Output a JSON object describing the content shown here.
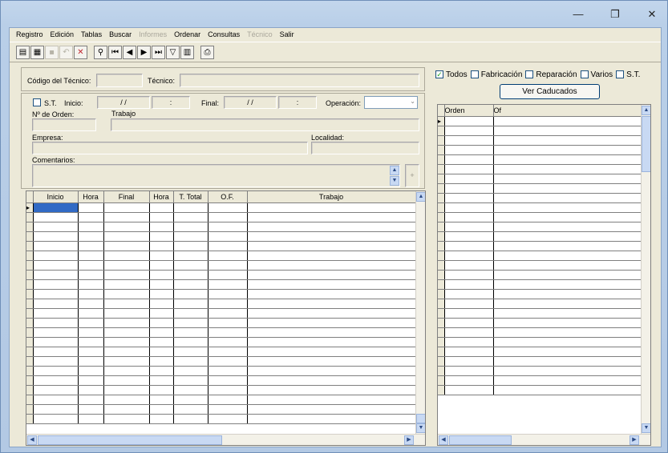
{
  "window": {
    "minimize": "—",
    "maximize": "❐",
    "close": "✕"
  },
  "menu": [
    {
      "label": "Registro",
      "enabled": true
    },
    {
      "label": "Edición",
      "enabled": true
    },
    {
      "label": "Tablas",
      "enabled": true
    },
    {
      "label": "Buscar",
      "enabled": true
    },
    {
      "label": "Informes",
      "enabled": false
    },
    {
      "label": "Ordenar",
      "enabled": true
    },
    {
      "label": "Consultas",
      "enabled": true
    },
    {
      "label": "Técnico",
      "enabled": false
    },
    {
      "label": "Salir",
      "enabled": true
    }
  ],
  "toolbar": {
    "icons": [
      {
        "name": "new-record-icon",
        "glyph": "▤",
        "enabled": true
      },
      {
        "name": "edit-record-icon",
        "glyph": "▦",
        "enabled": true
      },
      {
        "name": "save-icon",
        "glyph": "▪",
        "enabled": false
      },
      {
        "name": "undo-icon",
        "glyph": "↶",
        "enabled": false
      },
      {
        "name": "delete-icon",
        "glyph": "✕",
        "enabled": true
      },
      {
        "name": "find-icon",
        "glyph": "⚲",
        "enabled": true
      },
      {
        "name": "first-record-icon",
        "glyph": "⏮",
        "enabled": true
      },
      {
        "name": "previous-record-icon",
        "glyph": "◀",
        "enabled": true
      },
      {
        "name": "next-record-icon",
        "glyph": "▶",
        "enabled": true
      },
      {
        "name": "last-record-icon",
        "glyph": "⏭",
        "enabled": true
      },
      {
        "name": "filter-icon",
        "glyph": "▽",
        "enabled": true
      },
      {
        "name": "report-icon",
        "glyph": "▥",
        "enabled": true
      },
      {
        "name": "print-icon",
        "glyph": "⎙",
        "enabled": true
      }
    ]
  },
  "form": {
    "codigo_tecnico_label": "Código del Técnico:",
    "codigo_tecnico_value": "",
    "tecnico_label": "Técnico:",
    "tecnico_value": "",
    "st_label": "S.T.",
    "inicio_label": "Inicio:",
    "inicio_date": "/ /",
    "inicio_time": ":",
    "final_label": "Final:",
    "final_date": "/ /",
    "final_time": ":",
    "operacion_label": "Operación:",
    "operacion_value": "",
    "num_orden_label": "Nº de Orden:",
    "num_orden_value": "",
    "trabajo_label": "Trabajo",
    "trabajo_value": "",
    "empresa_label": "Empresa:",
    "empresa_value": "",
    "localidad_label": "Localidad:",
    "localidad_value": "",
    "comentarios_label": "Comentarios:",
    "comentarios_value": "",
    "plus_label": "+"
  },
  "left_grid": {
    "columns": [
      "Inicio",
      "Hora",
      "Final",
      "Hora",
      "T. Total",
      "O.F.",
      "Trabajo"
    ]
  },
  "filters": [
    {
      "label": "Todos",
      "checked": true
    },
    {
      "label": "Fabricación",
      "checked": false
    },
    {
      "label": "Reparación",
      "checked": false
    },
    {
      "label": "Varios",
      "checked": false
    },
    {
      "label": "S.T.",
      "checked": false
    }
  ],
  "ver_caducados_label": "Ver Caducados",
  "right_grid": {
    "columns": [
      "Orden",
      "Of"
    ]
  },
  "colors": {
    "selection": "#316ac5",
    "check": "#21a121"
  }
}
